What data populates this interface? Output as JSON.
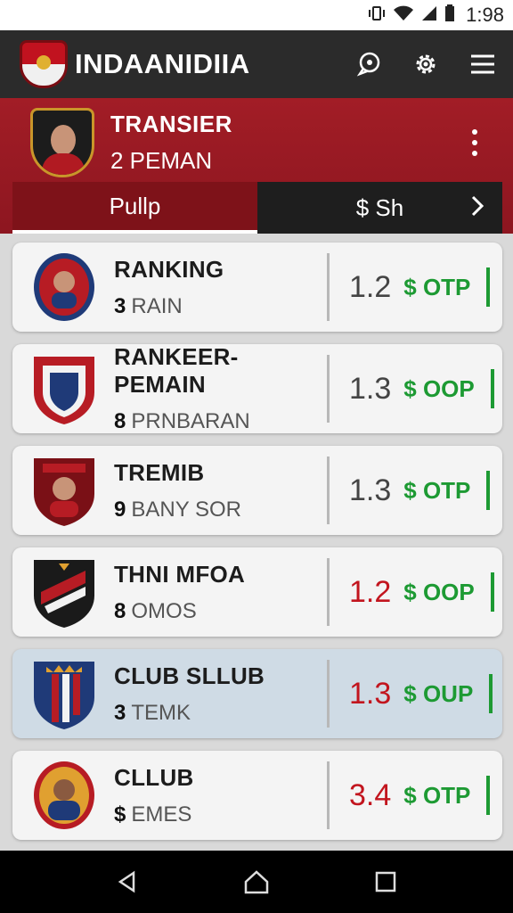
{
  "status_bar": {
    "time": "1:98",
    "icons": [
      "vibrate-icon",
      "wifi-icon",
      "signal-icon",
      "battery-icon"
    ]
  },
  "app_bar": {
    "title": "INDAANIDIIA",
    "icons": [
      "chat-icon",
      "settings-icon",
      "menu-icon"
    ]
  },
  "header": {
    "title": "TRANSIER",
    "subtitle": "2 PEMAN"
  },
  "tabs": [
    {
      "label": "Pullp",
      "active": true
    },
    {
      "label": "$ Sh",
      "active": false
    }
  ],
  "items": [
    {
      "title": "RANKING",
      "num": "3",
      "sub": "RAIN",
      "rating": "1.2",
      "price": "$ OTP",
      "rating_color": "#444444",
      "highlight": false
    },
    {
      "title": "RANKEER- PEMAIN",
      "num": "8",
      "sub": "PRNBARAN",
      "rating": "1.3",
      "price": "$ OOP",
      "rating_color": "#444444",
      "highlight": false
    },
    {
      "title": "TREMIB",
      "num": "9",
      "sub": "BANY SOR",
      "rating": "1.3",
      "price": "$ OTP",
      "rating_color": "#444444",
      "highlight": false
    },
    {
      "title": "THNI MFOA",
      "num": "8",
      "sub": "OMOS",
      "rating": "1.2",
      "price": "$ OOP",
      "rating_color": "#c2151e",
      "highlight": false
    },
    {
      "title": "CLUB SLLUB",
      "num": "3",
      "sub": "TEMK",
      "rating": "1.3",
      "price": "$ OUP",
      "rating_color": "#c2151e",
      "highlight": true
    },
    {
      "title": "CLLUB",
      "num": "$",
      "sub": "EMES",
      "rating": "3.4",
      "price": "$ OTP",
      "rating_color": "#c2151e",
      "highlight": false
    }
  ],
  "colors": {
    "brand_red": "#a21d26",
    "price_green": "#1d9a33",
    "dark_bar": "#2b2b2b"
  }
}
